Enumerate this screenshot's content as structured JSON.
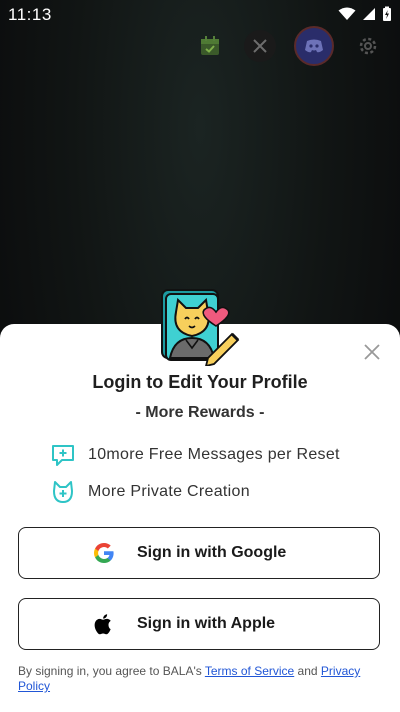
{
  "status_bar": {
    "time": "11:13"
  },
  "icons": {
    "calendar": "calendar-icon",
    "x": "x-icon",
    "discord": "discord-icon",
    "settings": "gear-icon",
    "close": "close-icon",
    "message_plus": "message-plus-icon",
    "cat_plus": "cat-plus-icon",
    "google": "google-logo-icon",
    "apple": "apple-logo-icon"
  },
  "sheet": {
    "title": "Login to Edit Your Profile",
    "subtitle": "- More Rewards -",
    "perks": [
      {
        "text": "10more Free Messages per Reset"
      },
      {
        "text": "More Private Creation"
      }
    ],
    "buttons": {
      "google": "Sign in with Google",
      "apple": "Sign in with Apple"
    },
    "legal": {
      "prefix": "By  signing in, you agree to BALA's ",
      "terms": "Terms of Service",
      "and": " and ",
      "privacy": "Privacy Policy"
    }
  },
  "colors": {
    "accent_teal": "#2ec4c6",
    "link": "#2156d6",
    "cat_yellow": "#f7cf5c",
    "heart_pink": "#f05a7e"
  }
}
